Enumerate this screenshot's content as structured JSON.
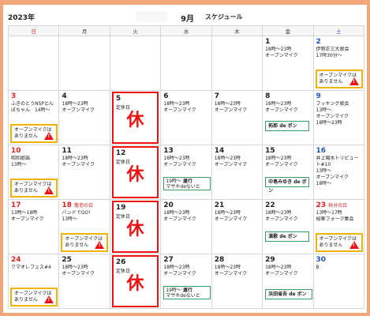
{
  "header": {
    "year": "2023年",
    "month": "9月",
    "subtitle": "スケジュール"
  },
  "weekdays": [
    "日",
    "月",
    "火",
    "水",
    "木",
    "金",
    "土"
  ],
  "common": {
    "hours": "18時～23時",
    "open": "オープンマイク",
    "closed_day": "定休日",
    "kyu": "休",
    "no_mic_1": "オープンマイクは",
    "no_mic_2": "ありません"
  },
  "cells": {
    "d1": {
      "day": "1"
    },
    "d2": {
      "day": "2",
      "l1": "伊勢正三大歌会",
      "l2": "17時30分～"
    },
    "d3": {
      "day": "3",
      "l1": "ふきのとうNSPとん",
      "l2": "ぼちゃん　14時～"
    },
    "d4": {
      "day": "4"
    },
    "d5": {
      "day": "5"
    },
    "d6": {
      "day": "6"
    },
    "d7": {
      "day": "7"
    },
    "d8": {
      "day": "8",
      "host": "拓郎 de ボン"
    },
    "d9": {
      "day": "9",
      "l1": "ブッキング歌会",
      "l2": "13時～",
      "l3": "オープンマイク",
      "l4": "18時～23時"
    },
    "d10": {
      "day": "10",
      "l1": "昭和歌謡",
      "l2": "13時～"
    },
    "d11": {
      "day": "11"
    },
    "d12": {
      "day": "12"
    },
    "d13": {
      "day": "13",
      "host_time": "19時～",
      "host_title": "遺行",
      "host_sub": "マサキdeないと"
    },
    "d14": {
      "day": "14"
    },
    "d15": {
      "day": "15",
      "host": "中島みゆき de ボン"
    },
    "d16": {
      "day": "16",
      "l1": "井上陽水トリビュー",
      "l2": "ト#10",
      "l3": "13時～",
      "l4": "オープンマイク",
      "l5": "18時～"
    },
    "d17": {
      "day": "17",
      "l1": "13時～18時",
      "l2": "オープンマイク"
    },
    "d18": {
      "day": "18",
      "holiday": "敬老の日",
      "l1": "バンドでGO！",
      "l2": "13時～"
    },
    "d19": {
      "day": "19"
    },
    "d20": {
      "day": "20"
    },
    "d21": {
      "day": "21"
    },
    "d22": {
      "day": "22",
      "host": "演歌 de ボン"
    },
    "d23": {
      "day": "23",
      "holiday": "秋分の日",
      "l1": "13時～17時",
      "l2": "桜華フォーク集会"
    },
    "d24": {
      "day": "24",
      "l1": "クマオレフェス#4"
    },
    "d25": {
      "day": "25"
    },
    "d26": {
      "day": "26"
    },
    "d27": {
      "day": "27",
      "host_time": "19時～",
      "host_title": "遺行",
      "host_sub": "マサキdeないと"
    },
    "d28": {
      "day": "28"
    },
    "d29": {
      "day": "29",
      "host": "浜田省吾 de ボン"
    },
    "d30": {
      "day": "30",
      "l1": "B"
    }
  }
}
